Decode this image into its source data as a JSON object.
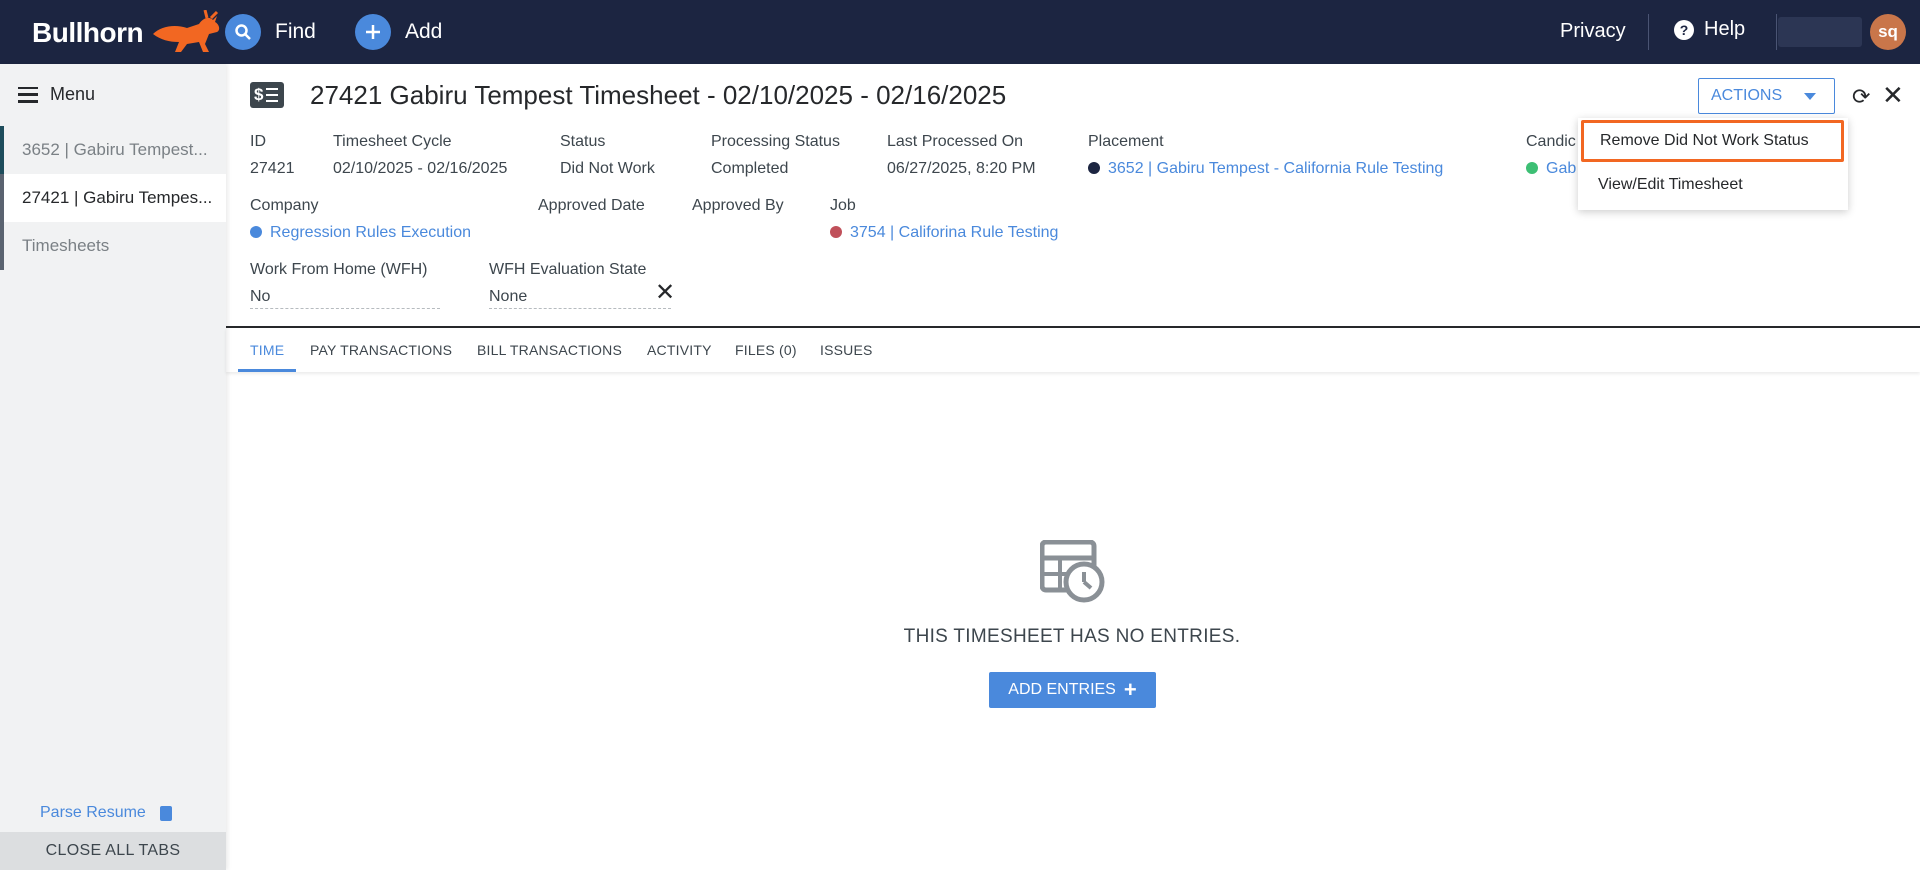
{
  "topbar": {
    "logo_text": "Bullhorn",
    "find_label": "Find",
    "add_label": "Add",
    "privacy_label": "Privacy",
    "help_label": "Help",
    "avatar_initials": "sq"
  },
  "sidebar": {
    "menu_label": "Menu",
    "tabs": [
      {
        "label": "3652 | Gabiru Tempest..."
      },
      {
        "label": "27421 | Gabiru Tempes..."
      },
      {
        "label": "Timesheets"
      }
    ],
    "parse_resume_label": "Parse Resume",
    "close_all_label": "CLOSE ALL TABS"
  },
  "header": {
    "title": "27421  Gabiru Tempest Timesheet - 02/10/2025 - 02/16/2025",
    "actions_label": "ACTIONS"
  },
  "fields": {
    "id": {
      "label": "ID",
      "value": "27421"
    },
    "cycle": {
      "label": "Timesheet Cycle",
      "value": "02/10/2025 - 02/16/2025"
    },
    "status": {
      "label": "Status",
      "value": "Did Not Work"
    },
    "processing": {
      "label": "Processing Status",
      "value": "Completed"
    },
    "last_processed": {
      "label": "Last Processed On",
      "value": "06/27/2025, 8:20 PM"
    },
    "placement": {
      "label": "Placement",
      "value": "3652 | Gabiru Tempest - California Rule Testing"
    },
    "candidate": {
      "label": "Candic",
      "value": "Gab"
    },
    "company": {
      "label": "Company",
      "value": "Regression Rules Execution"
    },
    "approved_date": {
      "label": "Approved Date",
      "value": ""
    },
    "approved_by": {
      "label": "Approved By",
      "value": ""
    },
    "job": {
      "label": "Job",
      "value": "3754 | Califorina Rule Testing"
    },
    "wfh": {
      "label": "Work From Home (WFH)",
      "value": "No"
    },
    "wfh_eval": {
      "label": "WFH Evaluation State",
      "value": "None"
    }
  },
  "tabs": [
    "TIME",
    "PAY TRANSACTIONS",
    "BILL TRANSACTIONS",
    "ACTIVITY",
    "FILES (0)",
    "ISSUES"
  ],
  "empty_state": {
    "message": "THIS TIMESHEET HAS NO ENTRIES.",
    "button_label": "ADD ENTRIES"
  },
  "actions_menu": {
    "items": [
      "Remove Did Not Work Status",
      "View/Edit Timesheet"
    ]
  },
  "colors": {
    "topbar": "#1c2541",
    "accent": "#4a89dc",
    "highlight": "#f26722",
    "placement_dot": "#1c2541",
    "candidate_dot": "#3dbf74",
    "company_dot": "#4a89dc",
    "job_dot": "#c0505a"
  }
}
